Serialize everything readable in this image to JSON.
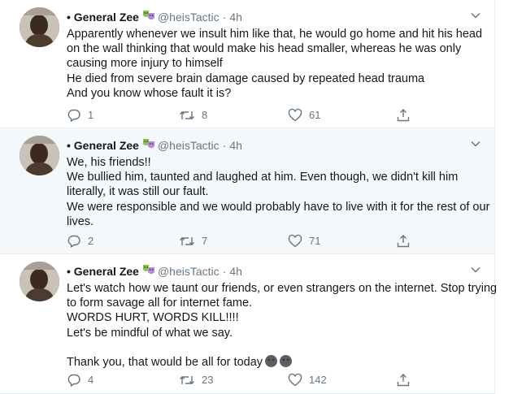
{
  "colors": {
    "text": "#14171a",
    "secondary": "#657786",
    "highlight": "#f5f8fa",
    "border": "#e6ecf0"
  },
  "tweets": [
    {
      "name": "• General Zee",
      "handle": "@heisTactic",
      "separator": "·",
      "time": "4h",
      "lines": [
        "Apparently whenever we insult him like that, he would go home and hit his head",
        "on the wall thinking that would make his head smaller, whereas he was only",
        "causing more injury to himself",
        "He died from severe brain damage caused by repeated head trauma",
        "And you know whose fault it is?"
      ],
      "replies": "1",
      "retweets": "8",
      "likes": "61"
    },
    {
      "name": "• General Zee",
      "handle": "@heisTactic",
      "separator": "·",
      "time": "4h",
      "lines": [
        "We, his friends!!",
        "We bullied him, taunted and laughed at him. Even though, we didn't kill him",
        "literally, it was still our fault.",
        "We were responsible and we would probably have to live with it for the rest of our",
        "lives."
      ],
      "replies": "2",
      "retweets": "7",
      "likes": "71"
    },
    {
      "name": "• General Zee",
      "handle": "@heisTactic",
      "separator": "·",
      "time": "4h",
      "lines": [
        "Let's watch how we taunt our friends, or even strangers on the internet. Stop trying",
        "to form savage all for internet fame.",
        "WORDS HURT, WORDS KILL!!!!",
        "Let's be mindful of what we say.",
        "",
        "Thank you, that would be all for today"
      ],
      "replies": "4",
      "retweets": "23",
      "likes": "142"
    }
  ],
  "icons": {
    "reply": "reply-icon",
    "retweet": "retweet-icon",
    "like": "heart-icon",
    "share": "share-icon",
    "caret": "chevron-down-icon",
    "badge": "theater-masks-icon",
    "emoji": "neutral-face-emoji"
  }
}
